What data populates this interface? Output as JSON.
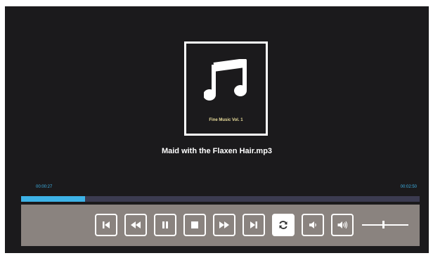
{
  "album": {
    "label": "Fine Music Vol. 1",
    "icon": "music-note-icon"
  },
  "track": {
    "title": "Maid with the Flaxen  Hair.mp3"
  },
  "playback": {
    "elapsed": "00:00:27",
    "total": "00:02:50",
    "progress_fraction": 0.16
  },
  "volume": {
    "level_fraction": 0.45
  },
  "colors": {
    "background": "#1b1a1c",
    "accent": "#3db2e6",
    "control_bar": "#8a837f",
    "progress_track": "#3b3b50"
  },
  "buttons": [
    {
      "name": "skip-to-start-button",
      "icon": "skip-previous-icon",
      "active": false
    },
    {
      "name": "rewind-button",
      "icon": "rewind-icon",
      "active": false
    },
    {
      "name": "pause-button",
      "icon": "pause-icon",
      "active": false
    },
    {
      "name": "stop-button",
      "icon": "stop-icon",
      "active": false
    },
    {
      "name": "fast-forward-button",
      "icon": "fast-forward-icon",
      "active": false
    },
    {
      "name": "skip-to-end-button",
      "icon": "skip-next-icon",
      "active": false
    },
    {
      "name": "loop-button",
      "icon": "loop-icon",
      "active": true
    },
    {
      "name": "volume-down-button",
      "icon": "volume-low-icon",
      "active": false
    },
    {
      "name": "volume-up-button",
      "icon": "volume-high-icon",
      "active": false
    }
  ]
}
